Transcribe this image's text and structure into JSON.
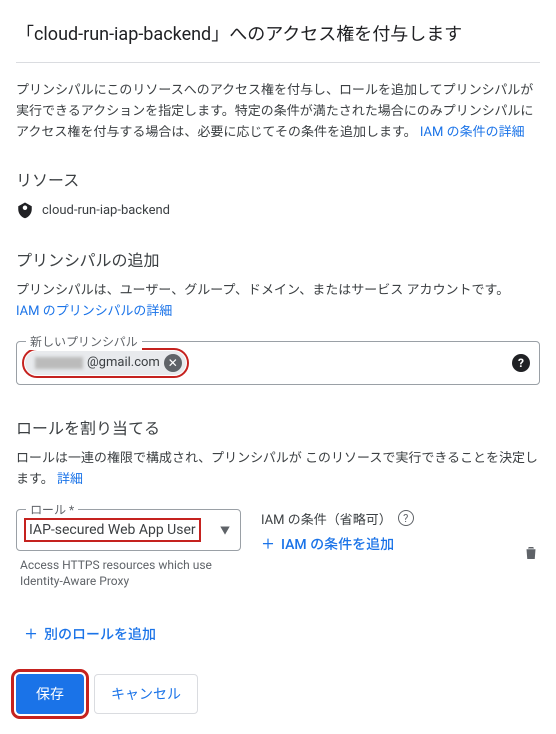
{
  "header": {
    "title": "「cloud-run-iap-backend」へのアクセス権を付与します"
  },
  "description": "プリンシパルにこのリソースへのアクセス権を付与し、ロールを追加してプリンシパルが実行できるアクションを指定します。特定の条件が満たされた場合にのみプリンシパルにアクセス権を付与する場合は、必要に応じてその条件を追加します。",
  "iam_conditions_link": "IAM の条件の詳細",
  "resource": {
    "heading": "リソース",
    "name": "cloud-run-iap-backend"
  },
  "principals": {
    "heading": "プリンシパルの追加",
    "desc": "プリンシパルは、ユーザー、グループ、ドメイン、またはサービス アカウントです。",
    "link": "IAM のプリンシパルの詳細",
    "input_label": "新しいプリンシパル",
    "chip_suffix": "@gmail.com"
  },
  "roles": {
    "heading": "ロールを割り当てる",
    "desc": "ロールは一連の権限で構成され、プリンシパルが このリソースで実行できることを決定します。",
    "link": "詳細",
    "role_label": "ロール *",
    "role_value": "IAP-secured Web App User",
    "role_helper": "Access HTTPS resources which use Identity-Aware Proxy",
    "condition_header": "IAM の条件（省略可）",
    "add_condition": "IAM の条件を追加",
    "add_another": "別のロールを追加"
  },
  "footer": {
    "save": "保存",
    "cancel": "キャンセル"
  }
}
